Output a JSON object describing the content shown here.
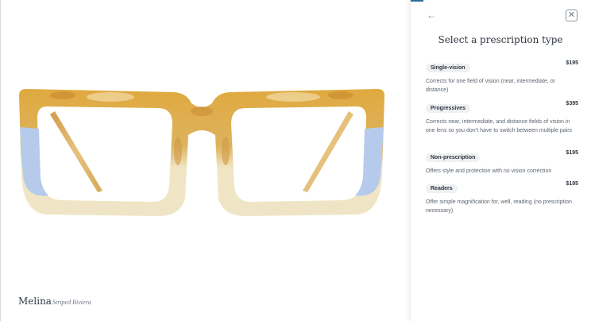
{
  "product": {
    "name": "Melina",
    "color": "Striped Riviera"
  },
  "panel": {
    "back_icon": "arrow-left-icon",
    "close_icon": "close-icon",
    "title": "Select a prescription type",
    "options": [
      {
        "label": "Single-vision",
        "price": "$195",
        "description": "Corrects for one field of vision (near, intermediate, or distance)"
      },
      {
        "label": "Progressives",
        "price": "$395",
        "description": "Corrects near, intermediate, and distance fields of vision in one lens so you don’t have to switch between multiple pairs"
      },
      {
        "label": "Non-prescription",
        "price": "$195",
        "description": "Offers style and protection with no vision correction"
      },
      {
        "label": "Readers",
        "price": "$195",
        "description": "Offer simple magnification for, well, reading (no prescription necessary)"
      }
    ]
  },
  "colors": {
    "accent": "#2c6c9c",
    "frame_tortoise": "#d9a441",
    "frame_blue": "#b6cbeb",
    "frame_cream": "#efe6c6"
  }
}
